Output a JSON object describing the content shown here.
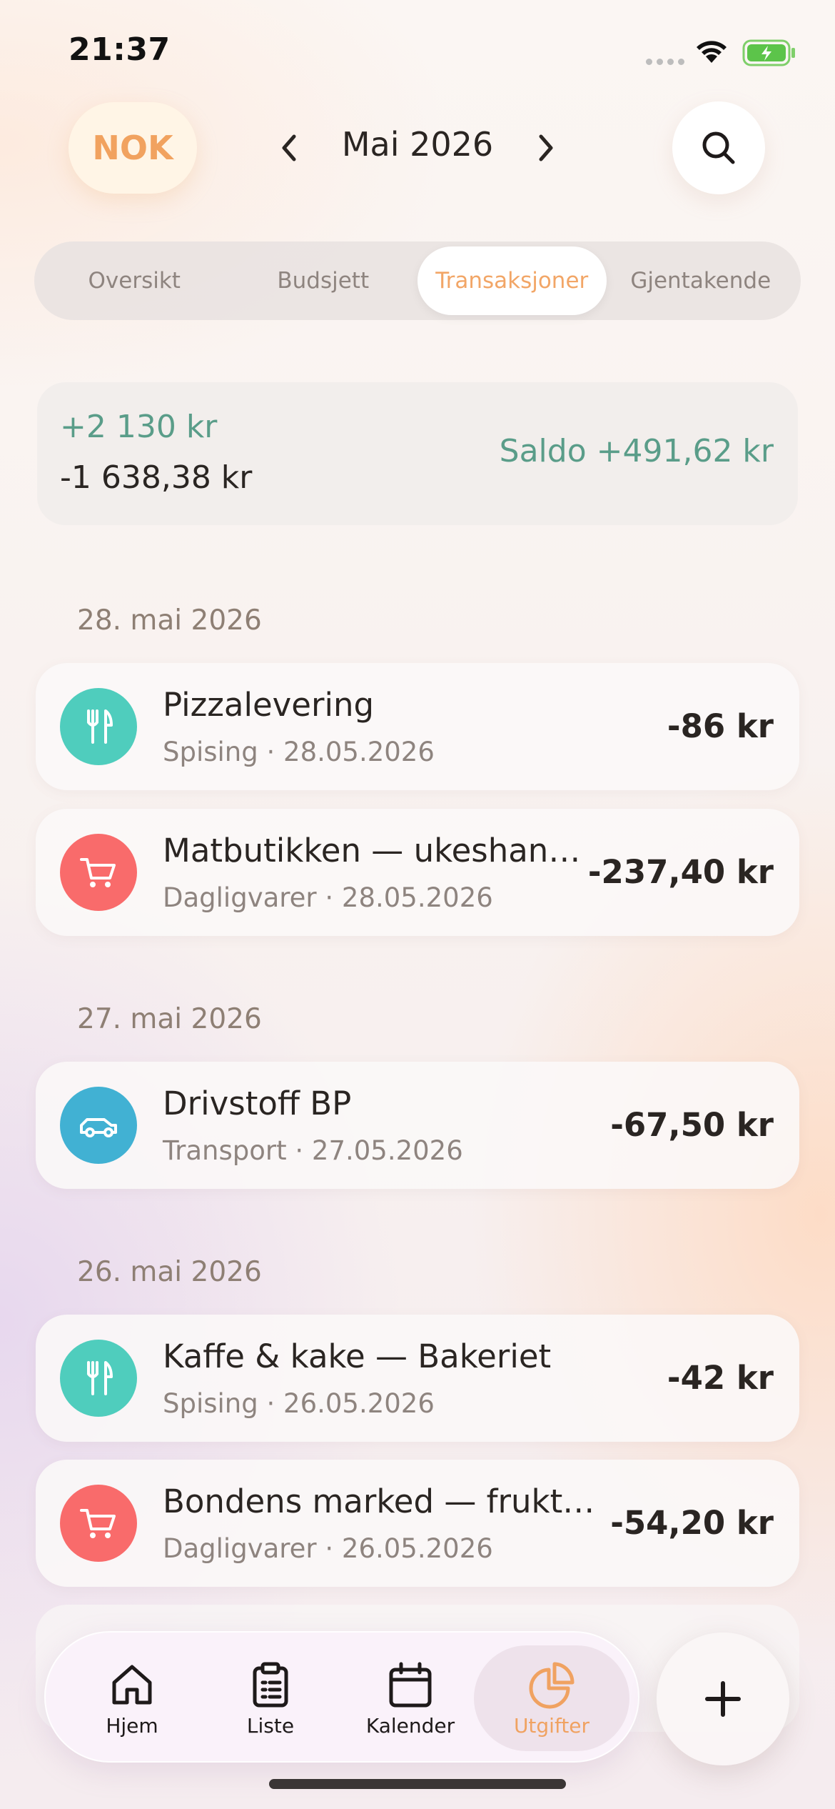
{
  "status_bar": {
    "time": "21:37"
  },
  "header": {
    "currency": "NOK",
    "month": "Mai 2026"
  },
  "tabs": [
    {
      "label": "Oversikt",
      "active": false
    },
    {
      "label": "Budsjett",
      "active": false
    },
    {
      "label": "Transaksjoner",
      "active": true
    },
    {
      "label": "Gjentakende",
      "active": false
    }
  ],
  "summary": {
    "income": "+2 130 kr",
    "expense": "-1 638,38 kr",
    "balance": "Saldo +491,62 kr"
  },
  "groups": [
    {
      "date": "28. mai 2026",
      "items": [
        {
          "title": "Pizzalevering",
          "subtitle": "Spising · 28.05.2026",
          "amount": "-86 kr",
          "icon": "fork-knife-icon",
          "color": "#4fcdbd"
        },
        {
          "title": "Matbutikken — ukeshan…",
          "subtitle": "Dagligvarer · 28.05.2026",
          "amount": "-237,40 kr",
          "icon": "shopping-cart-icon",
          "color": "#f96b6b"
        }
      ]
    },
    {
      "date": "27. mai 2026",
      "items": [
        {
          "title": "Drivstoff BP",
          "subtitle": "Transport · 27.05.2026",
          "amount": "-67,50 kr",
          "icon": "car-icon",
          "color": "#41b1d3"
        }
      ]
    },
    {
      "date": "26. mai 2026",
      "items": [
        {
          "title": "Kaffe & kake — Bakeriet",
          "subtitle": "Spising · 26.05.2026",
          "amount": "-42 kr",
          "icon": "fork-knife-icon",
          "color": "#4fcdbd"
        },
        {
          "title": "Bondens marked — frukt…",
          "subtitle": "Dagligvarer · 26.05.2026",
          "amount": "-54,20 kr",
          "icon": "shopping-cart-icon",
          "color": "#f96b6b"
        }
      ]
    }
  ],
  "nav": {
    "home": "Hjem",
    "list": "Liste",
    "calendar": "Kalender",
    "expenses": "Utgifter"
  },
  "colors": {
    "accent": "#f0a261",
    "income": "#5a9d89"
  }
}
